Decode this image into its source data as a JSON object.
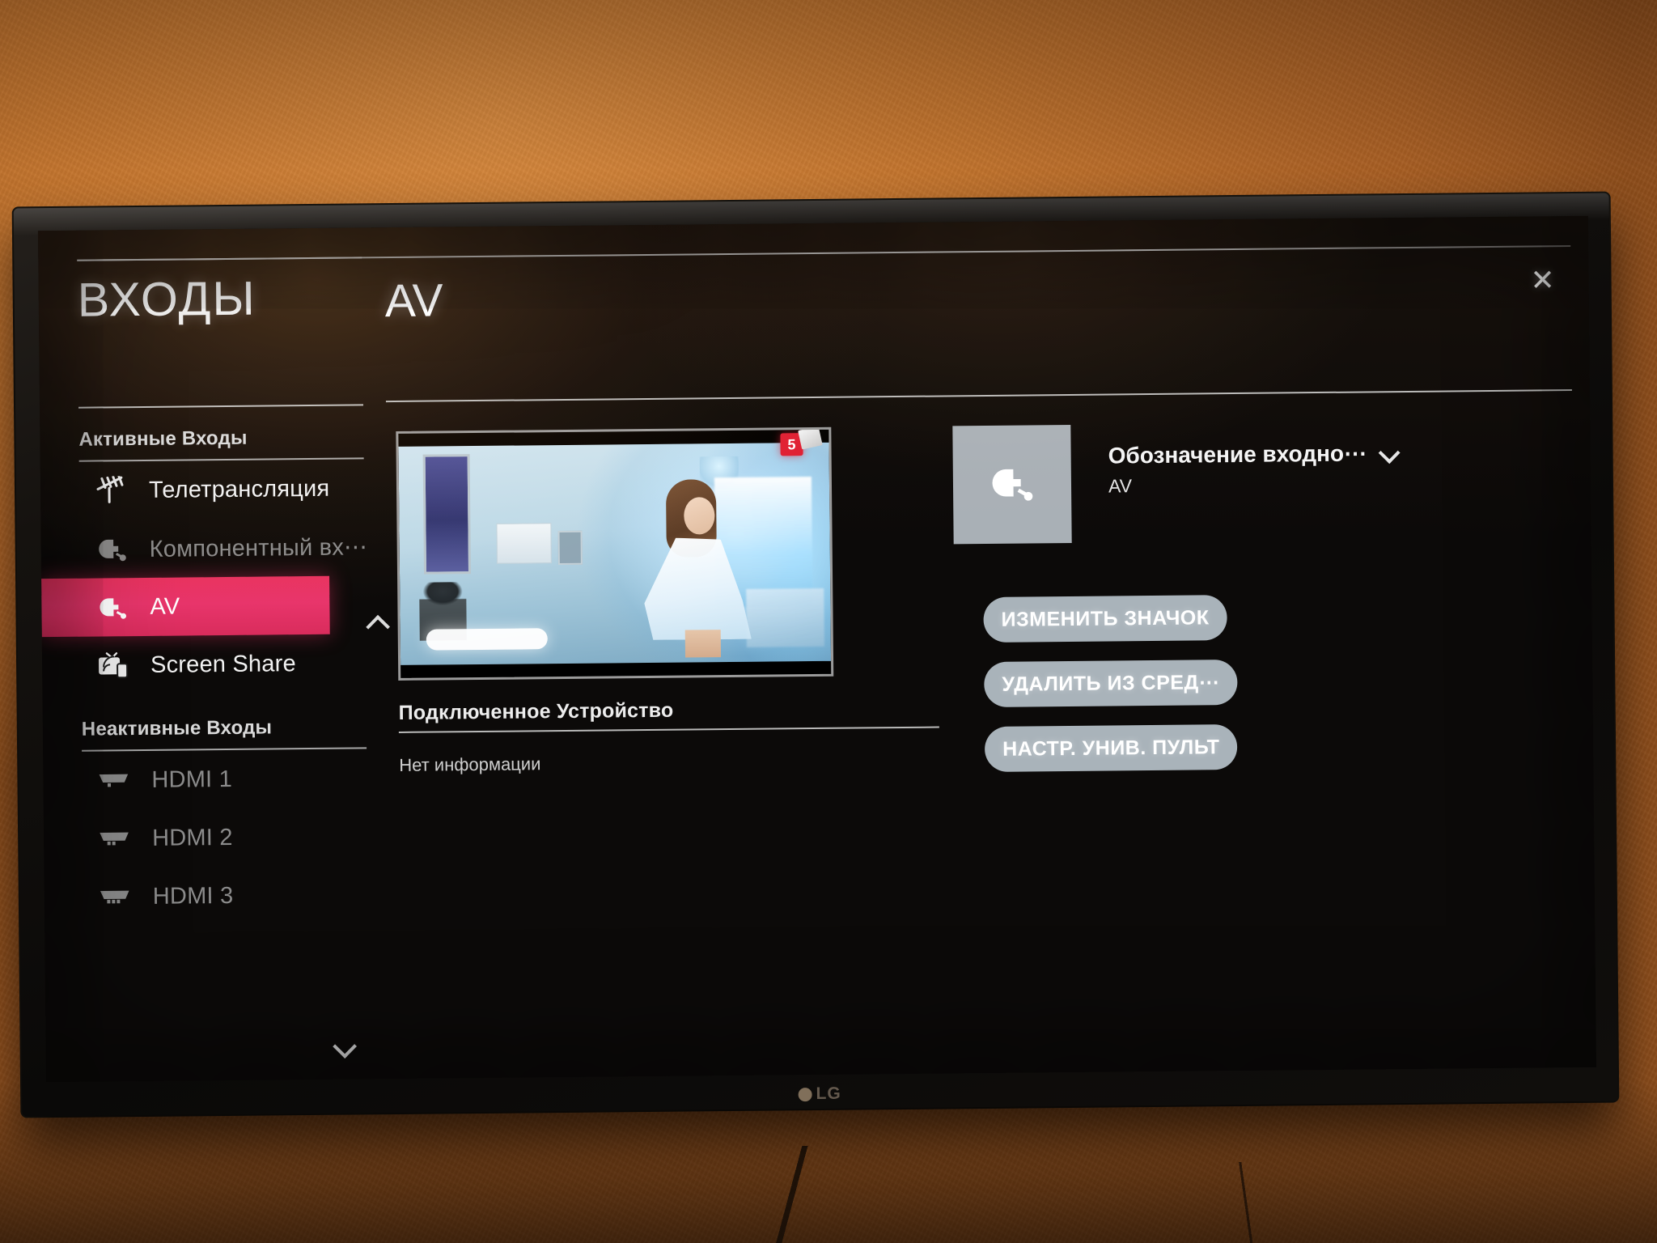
{
  "window": {
    "tv_brand": "LG"
  },
  "header": {
    "page_title": "ВХОДЫ",
    "panel_title": "AV",
    "close_label": "✕"
  },
  "sidebar": {
    "sections": [
      {
        "title": "Активные Входы",
        "collapse_state": "expanded",
        "items": [
          {
            "label": "Телетрансляция",
            "icon": "antenna-icon",
            "state": "normal"
          },
          {
            "label": "Компонентный вх⋯",
            "icon": "component-plug-icon",
            "state": "dim"
          },
          {
            "label": "AV",
            "icon": "av-plug-icon",
            "state": "selected"
          },
          {
            "label": "Screen Share",
            "icon": "screen-share-icon",
            "state": "normal"
          }
        ]
      },
      {
        "title": "Неактивные Входы",
        "collapse_state": "expanded",
        "items": [
          {
            "label": "HDMI 1",
            "icon": "hdmi-icon",
            "state": "dim"
          },
          {
            "label": "HDMI 2",
            "icon": "hdmi-icon",
            "state": "dim"
          },
          {
            "label": "HDMI 3",
            "icon": "hdmi-icon",
            "state": "dim"
          }
        ]
      }
    ],
    "scroll_down_label": "▼"
  },
  "main": {
    "preview": {
      "badge_count": "5",
      "badge_icon": "sms-envelope-icon"
    },
    "connected_device": {
      "heading": "Подключенное Устройство",
      "info": "Нет информации"
    },
    "input_icon": "av-plug-icon",
    "dropdown": {
      "label": "Обозначение входно⋯",
      "value": "AV",
      "chevron": "chevron-down-icon"
    },
    "actions": [
      {
        "label": "ИЗМЕНИТЬ ЗНАЧОК"
      },
      {
        "label": "УДАЛИТЬ ИЗ СРЕД⋯"
      },
      {
        "label": "НАСТР. УНИВ. ПУЛЬТ"
      }
    ]
  },
  "colors": {
    "accent_pink": "#e8356b",
    "pill_gray": "#a9b3ba",
    "icon_box_gray": "#a9b0b6",
    "badge_red": "#e01f33",
    "wall_orange": "#c2742e",
    "screen_black": "#0c0a09"
  }
}
